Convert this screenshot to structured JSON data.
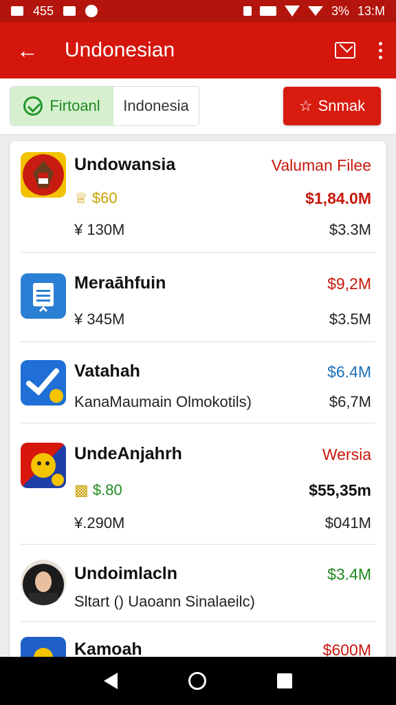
{
  "status_bar": {
    "left_text": "455",
    "battery": "3%",
    "time": "13:M"
  },
  "app_bar": {
    "title": "Undonesian"
  },
  "filter": {
    "active_chip": "Firtoanl",
    "inactive_chip": "Indonesia",
    "action_button": "Snmak"
  },
  "rows": [
    {
      "name": "Undowansia",
      "badge": "$60",
      "sub": "¥ 130M",
      "right_top": "Valuman Filee",
      "right_mid": "$1,84.0M",
      "right_bottom": "$3.3M"
    },
    {
      "name": "Meraāhfuin",
      "sub": "¥ 345M",
      "right_top": "$9,2M",
      "right_bottom": "$3.5M"
    },
    {
      "name": "Vatahah",
      "sub": "KanaMaumain Olmokotils)",
      "right_top": "$6.4M",
      "right_bottom": "$6,7M"
    },
    {
      "name": "UndeAnjahrh",
      "badge": "$.80",
      "sub": "¥.290M",
      "right_top": "Wersia",
      "right_mid": "$55,35m",
      "right_bottom": "$041M"
    },
    {
      "name": "Undoimlacln",
      "sub": "Sltart () Uaoann Sinalaeilc)",
      "right_top": "$3.4M"
    },
    {
      "name": "Kamoah",
      "right_top": "$600M"
    }
  ],
  "colors": {
    "primary": "#d4160c",
    "accent_green": "#20891f",
    "accent_red": "#c7170b",
    "accent_blue": "#1d72b8"
  }
}
